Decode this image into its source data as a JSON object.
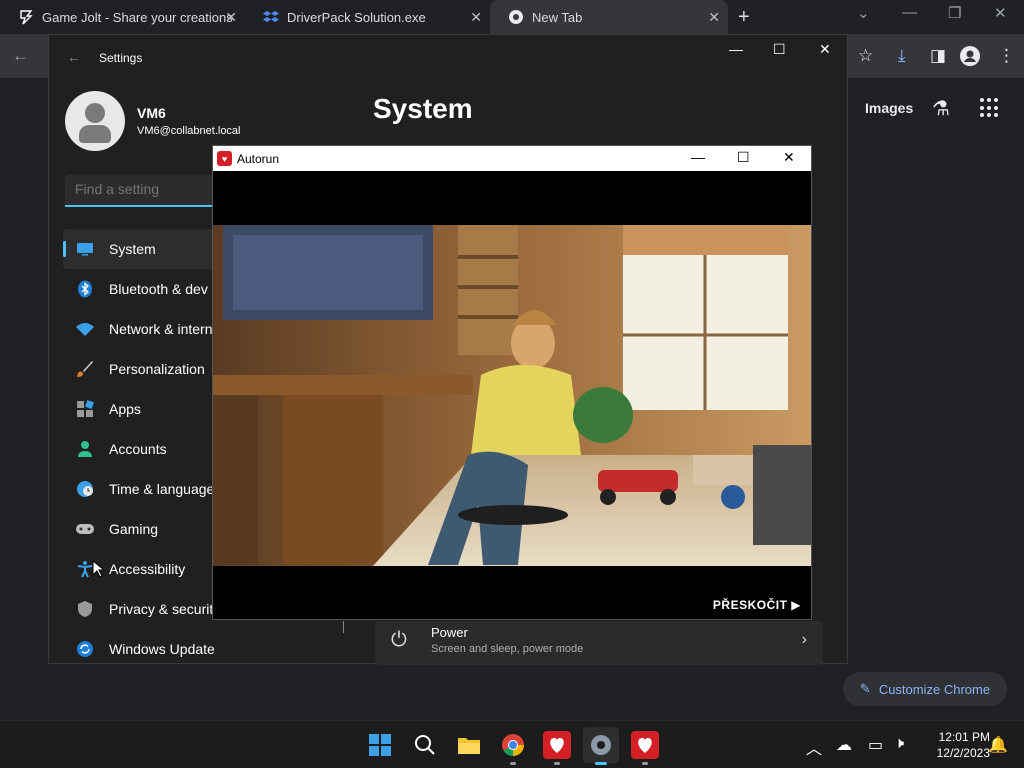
{
  "browser": {
    "tabs": [
      {
        "title": "Game Jolt - Share your creations",
        "icon": "gamejolt-icon"
      },
      {
        "title": "DriverPack Solution.exe",
        "icon": "dropbox-icon"
      },
      {
        "title": "New Tab",
        "icon": "chrome-icon"
      }
    ],
    "newtab_label": "+",
    "content": {
      "images_link": "Images",
      "customize_label": "Customize Chrome"
    }
  },
  "settings": {
    "window_title": "Settings",
    "user_name": "VM6",
    "user_email": "VM6@collabnet.local",
    "search_placeholder": "Find a setting",
    "page_title": "System",
    "nav": [
      {
        "label": "System",
        "icon": "monitor-icon",
        "active": true
      },
      {
        "label": "Bluetooth & dev",
        "icon": "bluetooth-icon"
      },
      {
        "label": "Network & intern",
        "icon": "wifi-icon"
      },
      {
        "label": "Personalization",
        "icon": "brush-icon"
      },
      {
        "label": "Apps",
        "icon": "apps-icon"
      },
      {
        "label": "Accounts",
        "icon": "person-icon"
      },
      {
        "label": "Time & language",
        "icon": "globe-clock-icon"
      },
      {
        "label": "Gaming",
        "icon": "gamepad-icon"
      },
      {
        "label": "Accessibility",
        "icon": "accessibility-icon"
      },
      {
        "label": "Privacy & securit",
        "icon": "shield-icon"
      },
      {
        "label": "Windows Update",
        "icon": "update-icon"
      }
    ],
    "power": {
      "title": "Power",
      "subtitle": "Screen and sleep, power mode"
    }
  },
  "autorun": {
    "window_title": "Autorun",
    "skip_label": "PŘESKOČIT ▶"
  },
  "taskbar": {
    "time": "12:01 PM",
    "date": "12/2/2023",
    "apps": [
      "windows-start",
      "search",
      "file-explorer",
      "chrome",
      "algida-autorun",
      "settings",
      "algida-autorun-2"
    ]
  },
  "colors": {
    "accent": "#4cc2ff",
    "chrome_link": "#8ab4f8",
    "brand_red": "#d41f26"
  }
}
